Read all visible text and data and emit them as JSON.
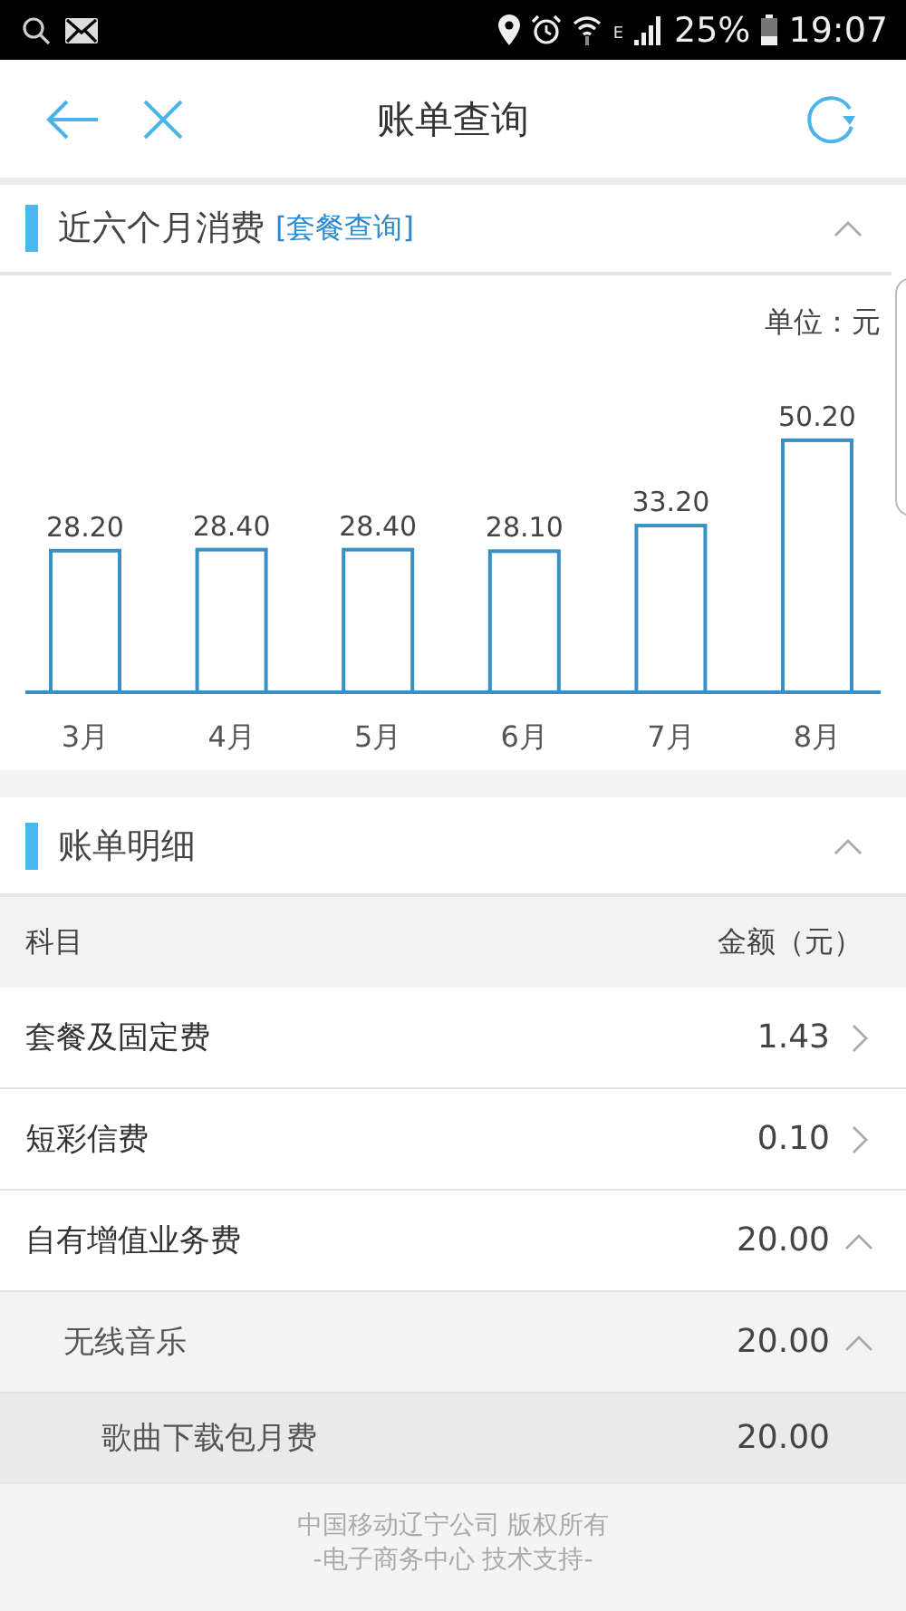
{
  "status_bar": {
    "network": "E",
    "battery": "25%",
    "time": "19:07"
  },
  "header": {
    "title": "账单查询"
  },
  "consumption": {
    "title": "近六个月消费",
    "link": "[套餐查询]",
    "expanded": true,
    "unit": "单位：元",
    "chart_data": {
      "type": "bar",
      "categories": [
        "3月",
        "4月",
        "5月",
        "6月",
        "7月",
        "8月"
      ],
      "values": [
        28.2,
        28.4,
        28.4,
        28.1,
        33.2,
        50.2
      ],
      "data_labels": true,
      "value_labels": [
        "28.20",
        "28.40",
        "28.40",
        "28.10",
        "33.20",
        "50.20"
      ]
    }
  },
  "details": {
    "title": "账单明细",
    "expanded": true,
    "columns": [
      "科目",
      "金额（元）"
    ],
    "rows": [
      {
        "name": "套餐及固定费",
        "amount": "1.43",
        "expanded": false
      },
      {
        "name": "短彩信费",
        "amount": "0.10",
        "expanded": false
      },
      {
        "name": "自有增值业务费",
        "amount": "20.00",
        "expanded": true,
        "children": [
          {
            "name": "无线音乐",
            "amount": "20.00",
            "expanded": true,
            "children": [
              {
                "name": "歌曲下载包月费",
                "amount": "20.00"
              }
            ]
          }
        ]
      }
    ]
  },
  "footer": [
    "中国移动辽宁公司 版权所有",
    "-电子商务中心 技术支持-"
  ]
}
